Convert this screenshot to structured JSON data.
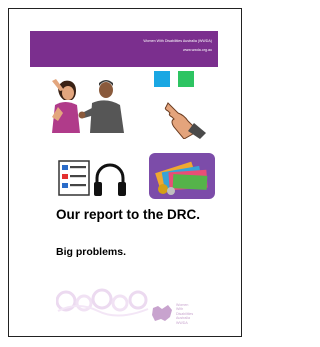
{
  "header": {
    "org_name": "Women With Disabilities Australia (WWDA)",
    "website": "www.wwda.org.au"
  },
  "icons": [
    {
      "name": "violence-icon"
    },
    {
      "name": "choice-squares-icon"
    },
    {
      "name": "easy-read-document-icon"
    },
    {
      "name": "headphones-icon"
    },
    {
      "name": "money-icon"
    }
  ],
  "colors": {
    "brand_purple": "#7b2f8e",
    "square_blue": "#1aa7e3",
    "square_green": "#2ec462",
    "money_bg": "#7c4ca9"
  },
  "main": {
    "title": "Our report to the DRC.",
    "subtitle": "Big problems."
  },
  "footer": {
    "logo_text": "Women\nWith\nDisabilities\nAustralia\nWWDA"
  }
}
